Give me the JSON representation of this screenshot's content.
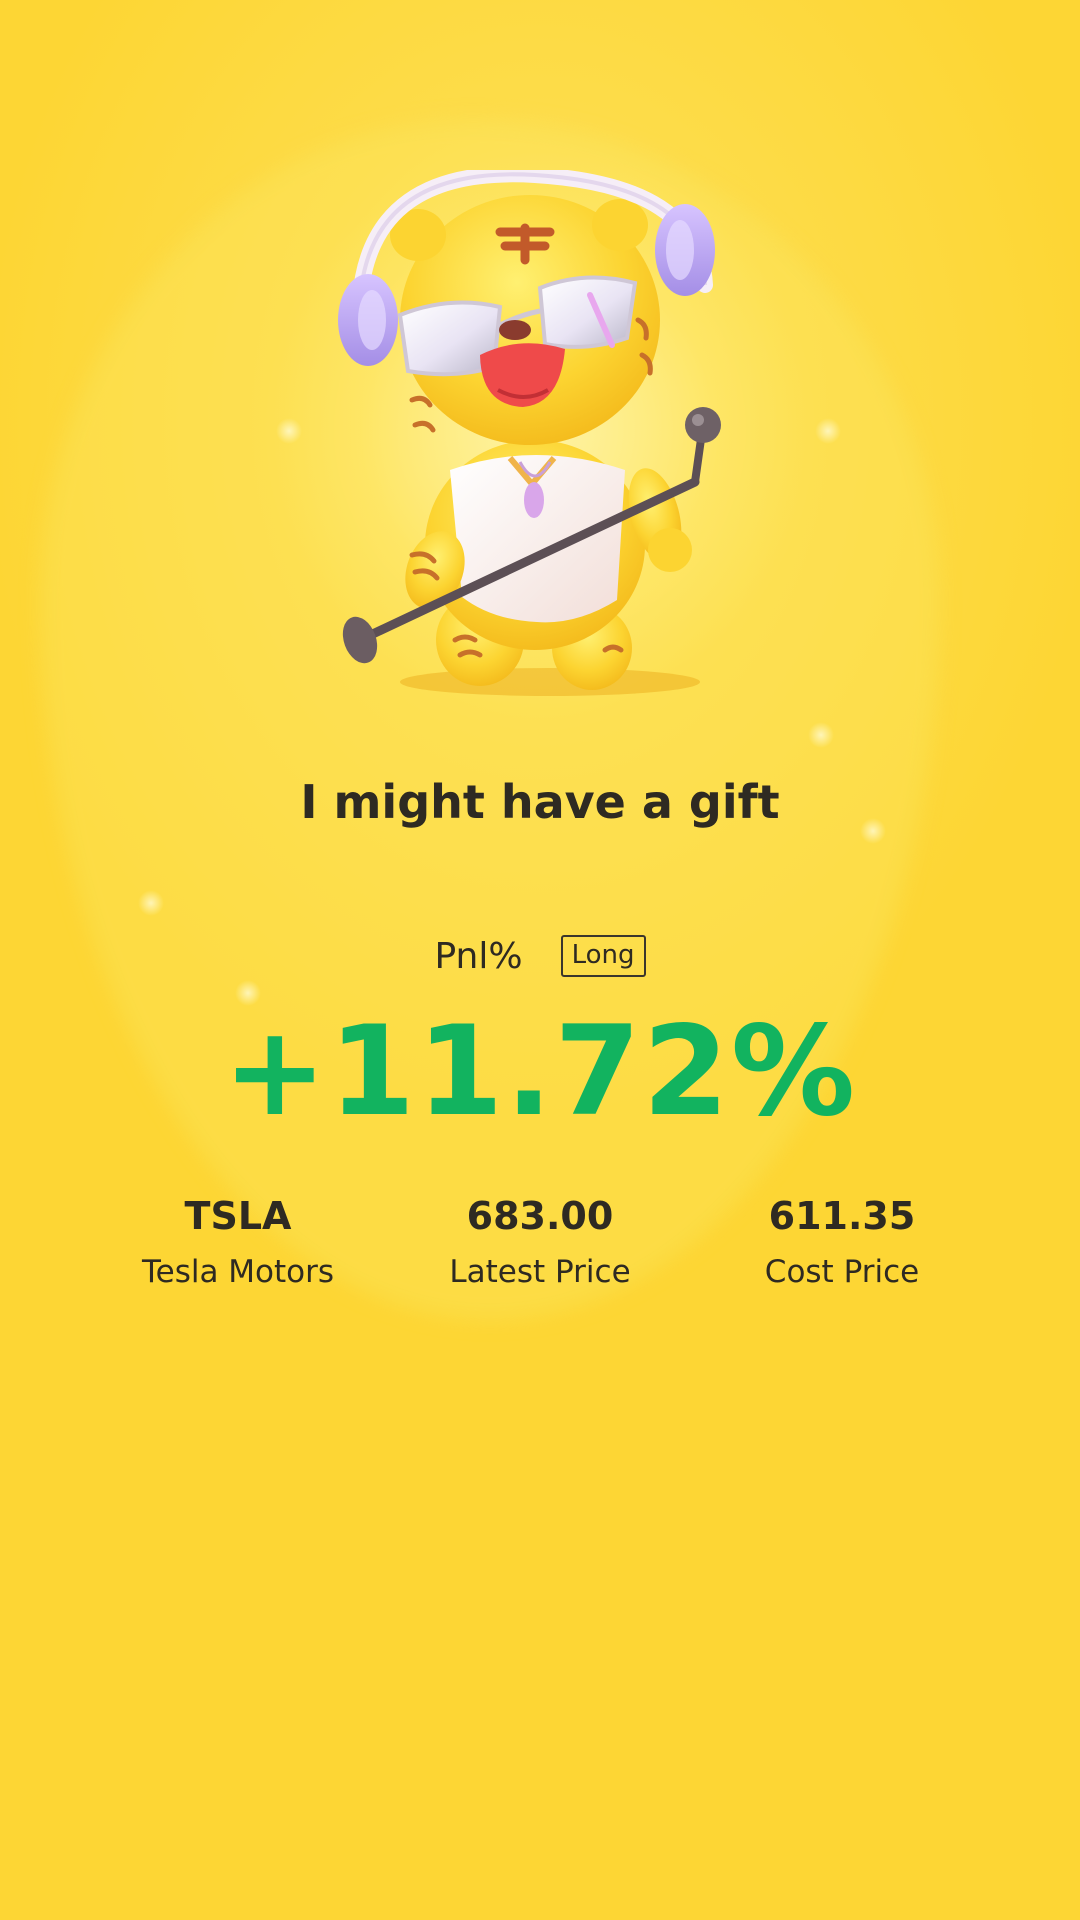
{
  "share_card": {
    "headline": "I might have a gift",
    "pnl_label": "Pnl%",
    "direction": "Long",
    "pnl_value": "+11.72%",
    "pnl_color": "#12b35f",
    "background_color": "#fdd634",
    "mascot_icon": "tiger-singer-mascot-icon"
  },
  "stats": [
    {
      "value": "TSLA",
      "label": "Tesla Motors"
    },
    {
      "value": "683.00",
      "label": "Latest Price"
    },
    {
      "value": "611.35",
      "label": "Cost Price"
    }
  ]
}
